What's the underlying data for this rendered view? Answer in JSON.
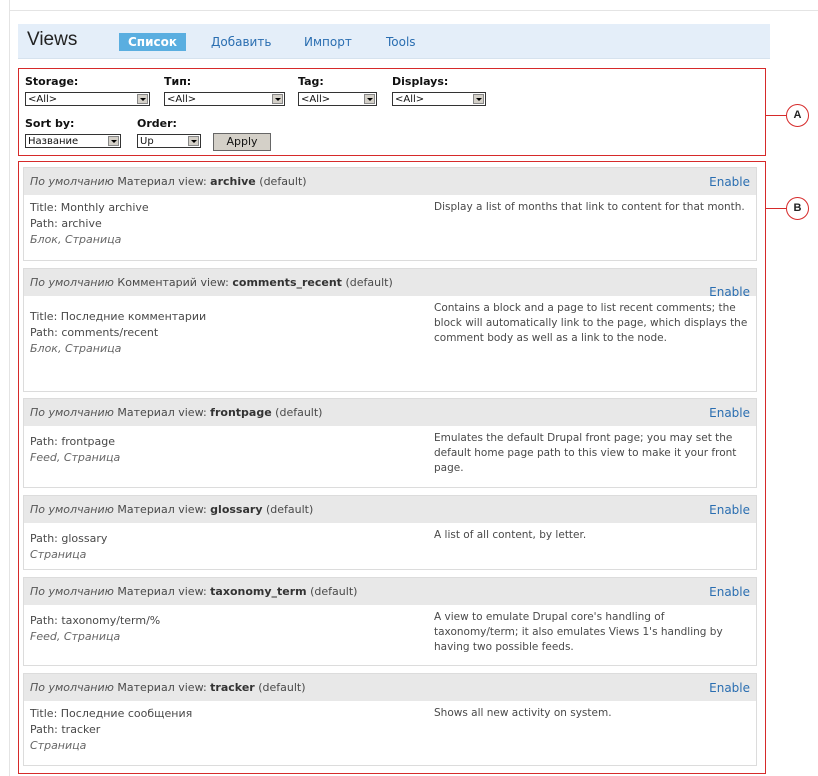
{
  "header": {
    "title": "Views",
    "tabs": [
      {
        "label": "Список",
        "active": true
      },
      {
        "label": "Добавить",
        "active": false
      },
      {
        "label": "Импорт",
        "active": false
      },
      {
        "label": "Tools",
        "active": false
      }
    ]
  },
  "filters": {
    "storage_label": "Storage:",
    "storage_value": "<All>",
    "type_label": "Тип:",
    "type_value": "<All>",
    "tag_label": "Tag:",
    "tag_value": "<All>",
    "displays_label": "Displays:",
    "displays_value": "<All>",
    "sort_label": "Sort by:",
    "sort_value": "Название",
    "order_label": "Order:",
    "order_value": "Up",
    "apply_label": "Apply"
  },
  "callouts": {
    "a": "A",
    "b": "B"
  },
  "views": [
    {
      "default_label": "По умолчанию",
      "type": "Материал",
      "view_word": "view:",
      "name": "archive",
      "status": "(default)",
      "enable": "Enable",
      "title": "Title: Monthly archive",
      "path": "Path: archive",
      "displays": "Блок, Страница",
      "description": "Display a list of months that link to content for that month."
    },
    {
      "default_label": "По умолчанию",
      "type": "Комментарий",
      "view_word": "view:",
      "name": "comments_recent",
      "status": "(default)",
      "enable": "Enable",
      "title": "Title: Последние комментарии",
      "path": "Path: comments/recent",
      "displays": "Блок, Страница",
      "description": "Contains a block and a page to list recent comments; the block will automatically link to the page, which displays the comment body as well as a link to the node."
    },
    {
      "default_label": "По умолчанию",
      "type": "Материал",
      "view_word": "view:",
      "name": "frontpage",
      "status": "(default)",
      "enable": "Enable",
      "title": "",
      "path": "Path: frontpage",
      "displays": "Feed, Страница",
      "description": "Emulates the default Drupal front page; you may set the default home page path to this view to make it your front page."
    },
    {
      "default_label": "По умолчанию",
      "type": "Материал",
      "view_word": "view:",
      "name": "glossary",
      "status": "(default)",
      "enable": "Enable",
      "title": "",
      "path": "Path: glossary",
      "displays": "Страница",
      "description": "A list of all content, by letter."
    },
    {
      "default_label": "По умолчанию",
      "type": "Материал",
      "view_word": "view:",
      "name": "taxonomy_term",
      "status": "(default)",
      "enable": "Enable",
      "title": "",
      "path": "Path: taxonomy/term/%",
      "displays": "Feed, Страница",
      "description": "A view to emulate Drupal core's handling of taxonomy/term; it also emulates Views 1's handling by having two possible feeds."
    },
    {
      "default_label": "По умолчанию",
      "type": "Материал",
      "view_word": "view:",
      "name": "tracker",
      "status": "(default)",
      "enable": "Enable",
      "title": "Title: Последние сообщения",
      "path": "Path: tracker",
      "displays": "Страница",
      "description": "Shows all new activity on system."
    }
  ],
  "colors": {
    "accent": "#5aaee0",
    "link": "#2a6eb1",
    "annotation_red": "#d62a2a",
    "row_header_bg": "#e8e8e8"
  }
}
